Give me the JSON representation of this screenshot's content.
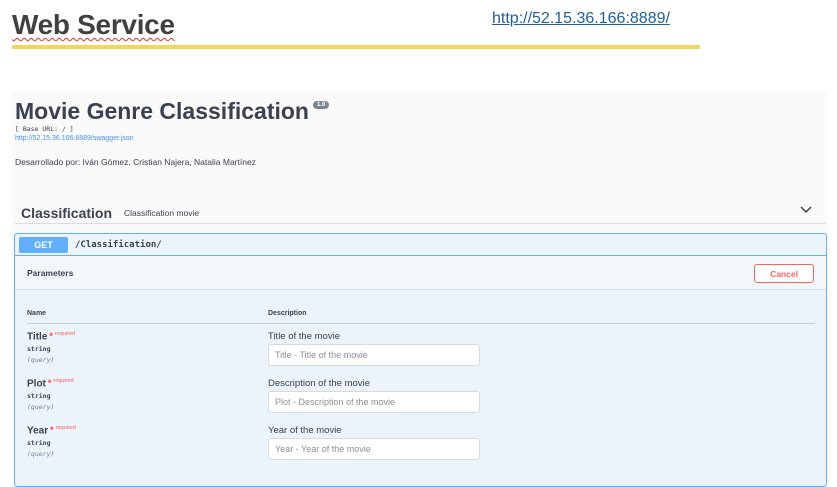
{
  "doc": {
    "title": "Web Service",
    "url": "http://52.15.36.166:8889/"
  },
  "api": {
    "title": "Movie Genre Classification",
    "version": "1.0",
    "base_url": "[ Base URL: / ]",
    "swagger_link": "http://52.15.36.166:8889/swagger.json",
    "developers": "Desarrollado por: Iván Gómez, Cristian Najera, Natalia Martínez"
  },
  "tag": {
    "name": "Classification",
    "description": "Classification movie"
  },
  "operation": {
    "method": "GET",
    "path": "/Classification/",
    "parameters_title": "Parameters",
    "cancel_label": "Cancel",
    "col_name": "Name",
    "col_description": "Description",
    "params": [
      {
        "name": "Title",
        "star": "*",
        "required": "required",
        "type": "string",
        "in": "(query)",
        "description": "Title of the movie",
        "placeholder": "Title - Title of the movie"
      },
      {
        "name": "Plot",
        "star": "*",
        "required": "required",
        "type": "string",
        "in": "(query)",
        "description": "Description of the movie",
        "placeholder": "Plot - Description of the movie"
      },
      {
        "name": "Year",
        "star": "*",
        "required": "required",
        "type": "string",
        "in": "(query)",
        "description": "Year of the movie",
        "placeholder": "Year - Year of the movie"
      }
    ]
  },
  "colors": {
    "get_method": "#61affe",
    "cancel": "#ff6060",
    "highlight_rule": "#f6d55c"
  },
  "icons": {
    "collapse": "chevron-down-icon"
  }
}
